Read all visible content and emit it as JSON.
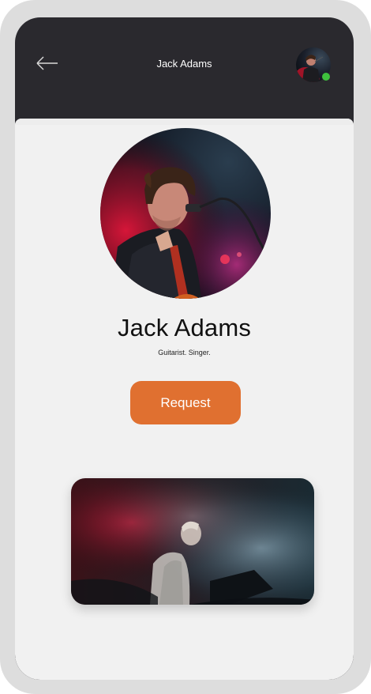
{
  "header": {
    "title": "Jack Adams",
    "back_icon": "back-arrow-icon",
    "online_status_color": "#3ec03e"
  },
  "profile": {
    "name": "Jack Adams",
    "tagline": "Guitarist. Singer."
  },
  "actions": {
    "request_label": "Request"
  },
  "colors": {
    "frame": "#dddddd",
    "header_bg": "#2a292e",
    "sheet_bg": "#f1f1f1",
    "accent": "#e07030"
  }
}
